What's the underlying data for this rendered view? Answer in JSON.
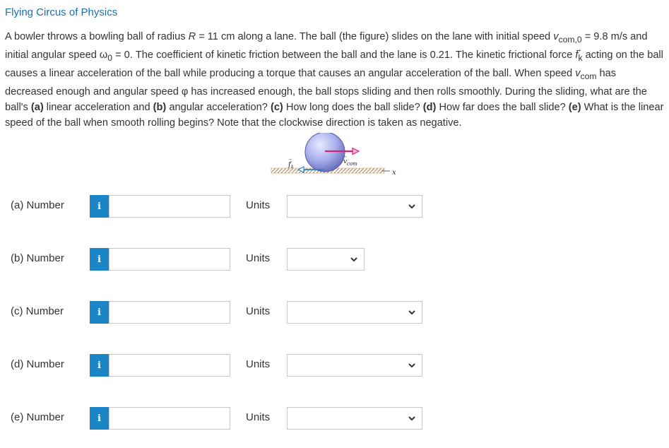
{
  "header": {
    "title": "Flying Circus of Physics"
  },
  "problem": {
    "t01": "A bowler throws a bowling ball of radius ",
    "t02": "R",
    "t03": " = 11 cm along a lane. The ball (the figure) slides on the lane with initial speed ",
    "t04": "v",
    "t05": "com,0",
    "t06": " = 9.8 m/s and initial angular speed ω",
    "t07": "0",
    "t08": " = 0. The coefficient of kinetic friction between the ball and the lane is 0.21. The kinetic frictional force ",
    "t09": "f",
    "t10": "k",
    "t11": " acting on the ball causes a linear acceleration of the ball while producing a torque that causes an angular acceleration of the ball. When speed ",
    "t12": "v",
    "t13": "com",
    "t14": " has decreased enough and angular speed φ has increased enough, the ball stops sliding and then rolls smoothly. During the sliding, what are the ball's ",
    "t15": "(a)",
    "t16": " linear acceleration and ",
    "t17": "(b)",
    "t18": " angular acceleration? ",
    "t19": "(c)",
    "t20": " How long does the ball slide? ",
    "t21": "(d)",
    "t22": " How far does the ball slide? ",
    "t23": "(e)",
    "t24": " What is the linear speed of the ball when smooth rolling begins? Note that the clockwise direction is taken as negative."
  },
  "figure": {
    "friction_label": "f",
    "friction_sub": "k",
    "velocity_label": "v",
    "velocity_sub": "com",
    "axis_label": "x"
  },
  "parts": [
    {
      "label": "(a)   Number",
      "info": "i",
      "value": "",
      "units_label": "Units",
      "unit_selected": ""
    },
    {
      "label": "(b)   Number",
      "info": "i",
      "value": "",
      "units_label": "Units",
      "unit_selected": ""
    },
    {
      "label": "(c)   Number",
      "info": "i",
      "value": "",
      "units_label": "Units",
      "unit_selected": ""
    },
    {
      "label": "(d)   Number",
      "info": "i",
      "value": "",
      "units_label": "Units",
      "unit_selected": ""
    },
    {
      "label": "(e)   Number",
      "info": "i",
      "value": "",
      "units_label": "Units",
      "unit_selected": ""
    }
  ],
  "colors": {
    "title": "#1a6fae",
    "info_button": "#1a86c8",
    "ball": "#9fa6e6",
    "velocity_arrow": "#d6237a"
  },
  "icons": {
    "info": "info-icon",
    "dropdown": "chevron-down-icon"
  }
}
